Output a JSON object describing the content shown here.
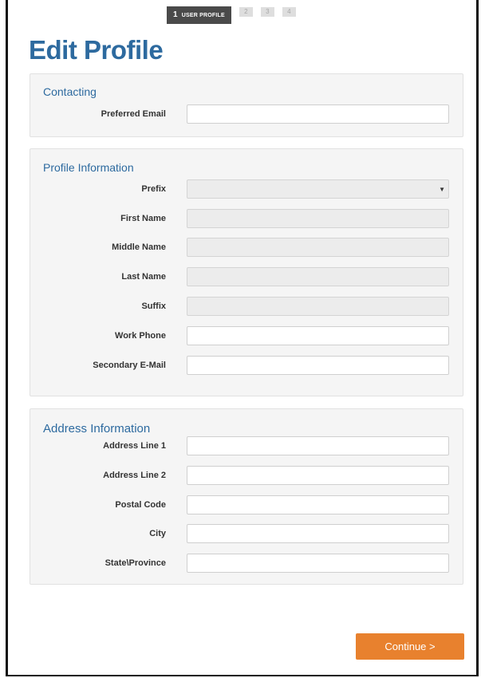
{
  "stepper": {
    "active_number": "1",
    "active_label": "USER PROFILE",
    "step2": "2",
    "step3": "3",
    "step4": "4"
  },
  "page_title": "Edit Profile",
  "contacting": {
    "title": "Contacting",
    "preferred_email": {
      "label": "Preferred Email",
      "value": ""
    }
  },
  "profile": {
    "title": "Profile Information",
    "prefix": {
      "label": "Prefix",
      "value": ""
    },
    "first_name": {
      "label": "First Name",
      "value": ""
    },
    "middle_name": {
      "label": "Middle Name",
      "value": ""
    },
    "last_name": {
      "label": "Last Name",
      "value": ""
    },
    "suffix": {
      "label": "Suffix",
      "value": ""
    },
    "work_phone": {
      "label": "Work Phone",
      "value": ""
    },
    "secondary_email": {
      "label": "Secondary E-Mail",
      "value": ""
    }
  },
  "address": {
    "title": "Address Information",
    "line1": {
      "label": "Address Line 1",
      "value": ""
    },
    "line2": {
      "label": "Address Line 2",
      "value": ""
    },
    "postal_code": {
      "label": "Postal Code",
      "value": ""
    },
    "city": {
      "label": "City",
      "value": ""
    },
    "state": {
      "label": "State\\Province",
      "value": ""
    }
  },
  "continue_label": "Continue >",
  "colors": {
    "accent": "#2d6a9f",
    "button": "#e8812e"
  }
}
